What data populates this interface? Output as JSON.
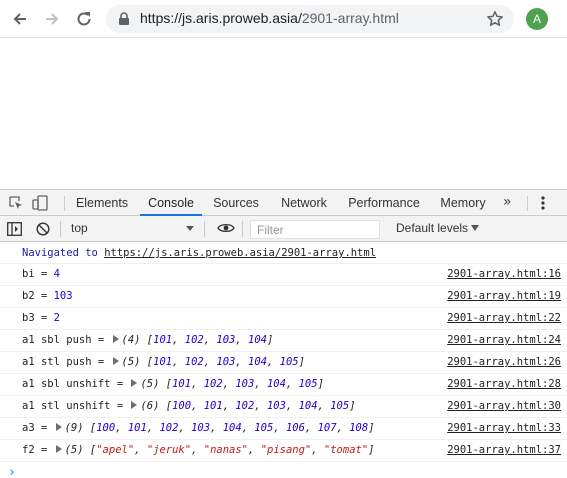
{
  "browser": {
    "url_host": "https://js.aris.proweb.asia/",
    "url_path": "2901-array.html",
    "avatar_initial": "A"
  },
  "devtools": {
    "tabs": [
      {
        "label": "Elements"
      },
      {
        "label": "Console"
      },
      {
        "label": "Sources"
      },
      {
        "label": "Network"
      },
      {
        "label": "Performance"
      },
      {
        "label": "Memory"
      }
    ],
    "active_tab": "Console",
    "more_tabs": "»",
    "toolbar": {
      "context": "top",
      "filter_placeholder": "Filter",
      "levels": "Default levels"
    }
  },
  "console": {
    "navigated_prefix": "Navigated to",
    "navigated_url": "https://js.aris.proweb.asia/2901-array.html",
    "rows": [
      {
        "label": "bi = ",
        "value": "4",
        "source": "2901-array.html:16"
      },
      {
        "label": "b2 = ",
        "value": "103",
        "source": "2901-array.html:19"
      },
      {
        "label": "b3 = ",
        "value": "2",
        "source": "2901-array.html:22"
      },
      {
        "label": "a1 sbl push = ",
        "count": "(4)",
        "items": [
          "101",
          "102",
          "103",
          "104"
        ],
        "kind": "num",
        "source": "2901-array.html:24"
      },
      {
        "label": "a1 stl push = ",
        "count": "(5)",
        "items": [
          "101",
          "102",
          "103",
          "104",
          "105"
        ],
        "kind": "num",
        "source": "2901-array.html:26"
      },
      {
        "label": "a1 sbl unshift = ",
        "count": "(5)",
        "items": [
          "101",
          "102",
          "103",
          "104",
          "105"
        ],
        "kind": "num",
        "source": "2901-array.html:28"
      },
      {
        "label": "a1 stl unshift = ",
        "count": "(6)",
        "items": [
          "100",
          "101",
          "102",
          "103",
          "104",
          "105"
        ],
        "kind": "num",
        "source": "2901-array.html:30"
      },
      {
        "label": "a3 = ",
        "count": "(9)",
        "items": [
          "100",
          "101",
          "102",
          "103",
          "104",
          "105",
          "106",
          "107",
          "108"
        ],
        "kind": "num",
        "source": "2901-array.html:33"
      },
      {
        "label": "f2 = ",
        "count": "(5)",
        "items": [
          "\"apel\"",
          "\"jeruk\"",
          "\"nanas\"",
          "\"pisang\"",
          "\"tomat\""
        ],
        "kind": "str",
        "source": "2901-array.html:37"
      }
    ],
    "prompt": "›"
  }
}
